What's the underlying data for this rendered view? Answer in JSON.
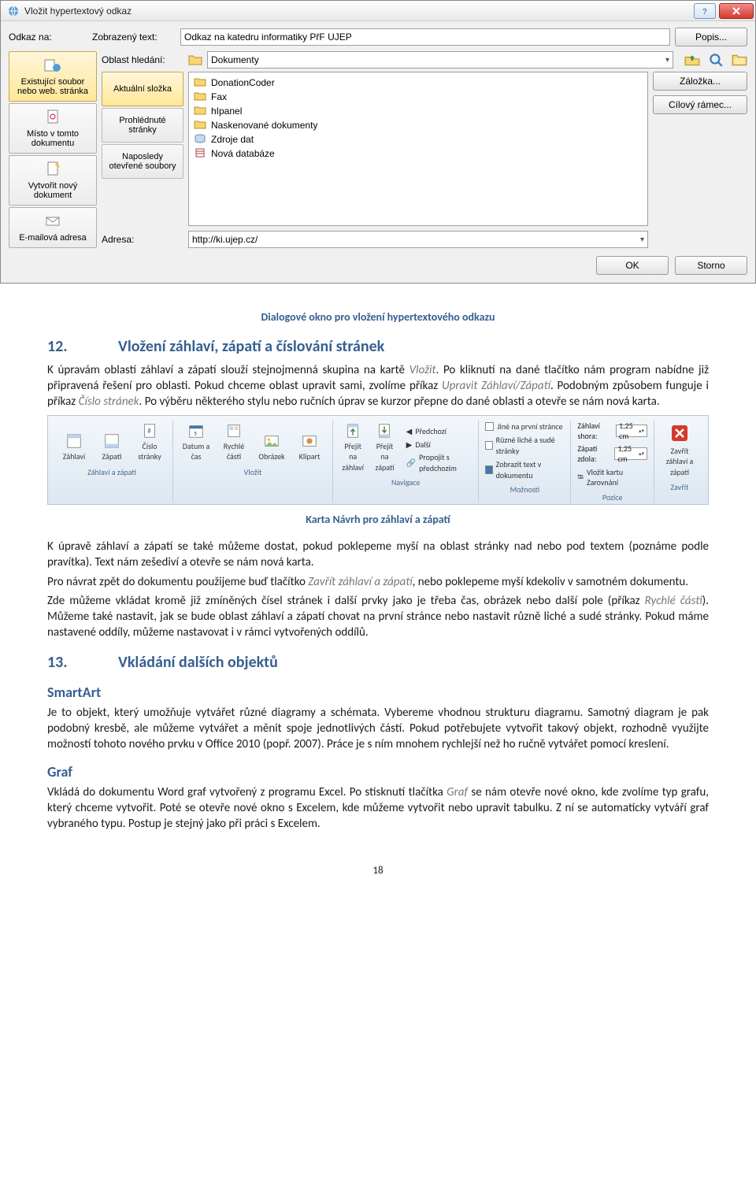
{
  "dialog": {
    "title": "Vložit hypertextový odkaz",
    "link_to_label": "Odkaz na:",
    "display_text_label": "Zobrazený text:",
    "display_text_value": "Odkaz na katedru informatiky PřF UJEP",
    "tooltip_btn": "Popis...",
    "left_tabs": [
      "Existující soubor nebo web. stránka",
      "Místo v tomto dokumentu",
      "Vytvořit nový dokument",
      "E-mailová adresa"
    ],
    "search_label": "Oblast hledání:",
    "search_value": "Dokumenty",
    "inner_tabs": [
      "Aktuální složka",
      "Prohlédnuté stránky",
      "Naposledy otevřené soubory"
    ],
    "files": [
      "DonationCoder",
      "Fax",
      "hIpanel",
      "Naskenované dokumenty",
      "Zdroje dat",
      "Nová databáze"
    ],
    "right_btns": [
      "Záložka...",
      "Cílový rámec..."
    ],
    "address_label": "Adresa:",
    "address_value": "http://ki.ujep.cz/",
    "ok": "OK",
    "cancel": "Storno"
  },
  "caption1": "Dialogové okno pro vložení hypertextového odkazu",
  "sec12_num": "12.",
  "sec12_title": "Vložení záhlaví, zápatí a číslování stránek",
  "p12a_1": "K úpravám oblastí záhlaví a zápatí slouží stejnojmenná skupina na kartě ",
  "p12a_vlozit": "Vložit",
  "p12a_2": ". Po kliknutí na dané tlačítko nám program nabídne již připravená řešení pro oblasti. Pokud chceme oblast upravit sami, zvolíme příkaz ",
  "p12a_upravit": "Upravit Záhlaví/Zápatí",
  "p12a_3": ". Podobným způsobem funguje i příkaz ",
  "p12a_cislo": "Číslo stránek",
  "p12a_4": ". Po výběru některého stylu nebo ručních úprav se kurzor přepne do dané oblasti a otevře se nám nová karta.",
  "ribbon": {
    "g1": {
      "b1": "Záhlaví",
      "b2": "Zápatí",
      "b3": "Číslo stránky",
      "label": "Záhlaví a zápatí"
    },
    "g2": {
      "b1": "Datum a čas",
      "b2": "Rychlé části",
      "b3": "Obrázek",
      "b4": "Klipart",
      "label": "Vložit"
    },
    "g3": {
      "b1": "Přejít na záhlaví",
      "b2": "Přejít na zápatí",
      "c1": "Předchozí",
      "c2": "Další",
      "c3": "Propojit s předchozím",
      "label": "Navigace"
    },
    "g4": {
      "c1": "Jiné na první stránce",
      "c2": "Různé liché a sudé stránky",
      "c3": "Zobrazit text v dokumentu",
      "label": "Možnosti"
    },
    "g5": {
      "s1l": "Záhlaví shora:",
      "s1v": "1,25 cm",
      "s2l": "Zápatí zdola:",
      "s2v": "1,25 cm",
      "s3": "Vložit kartu Zarovnání",
      "label": "Pozice"
    },
    "g6": {
      "b1": "Zavřít záhlaví a zápatí",
      "label": "Zavřít"
    }
  },
  "caption2": "Karta Návrh pro záhlaví a zápatí",
  "p12b": "K úpravě záhlaví a zápatí se také můžeme dostat, pokud poklepeme myší na oblast stránky nad nebo pod textem (poznáme podle pravítka). Text nám zešediví a otevře se nám nová karta.",
  "p12c_1": "Pro návrat zpět do dokumentu použijeme buď tlačítko ",
  "p12c_zavrit": "Zavřít záhlaví a zápatí",
  "p12c_2": ", nebo poklepeme myší kdekoliv v samotném dokumentu.",
  "p12d_1": "Zde můžeme vkládat kromě již zmíněných čísel stránek i další prvky jako je třeba čas, obrázek nebo další pole (příkaz ",
  "p12d_rychle": "Rychlé části",
  "p12d_2": "). Můžeme také nastavit, jak se bude oblast záhlaví a zápatí chovat na první stránce nebo nastavit různě liché a sudé stránky. Pokud máme nastavené oddíly, můžeme nastavovat i v rámci vytvořených oddílů.",
  "sec13_num": "13.",
  "sec13_title": "Vkládání dalších objektů",
  "smartart_h": "SmartArt",
  "smartart_p": "Je to objekt, který umožňuje vytvářet různé diagramy a schémata. Vybereme vhodnou strukturu diagramu. Samotný diagram je pak podobný kresbě, ale můžeme vytvářet a měnit spoje jednotlivých částí. Pokud potřebujete vytvořit takový objekt, rozhodně využijte možností tohoto nového prvku v Office 2010 (popř. 2007). Práce je s ním mnohem rychlejší než ho ručně vytvářet pomocí kreslení.",
  "graf_h": "Graf",
  "graf_p_1": "Vkládá do dokumentu Word graf vytvořený z programu Excel. Po stisknutí tlačítka ",
  "graf_p_graf": "Graf",
  "graf_p_2": " se nám otevře nové okno, kde zvolíme typ grafu, který chceme vytvořit. Poté se otevře nové okno s Excelem, kde můžeme vytvořit nebo upravit tabulku. Z ní se automaticky vytváří graf vybraného typu. Postup je stejný jako při práci s Excelem.",
  "pagenum": "18"
}
